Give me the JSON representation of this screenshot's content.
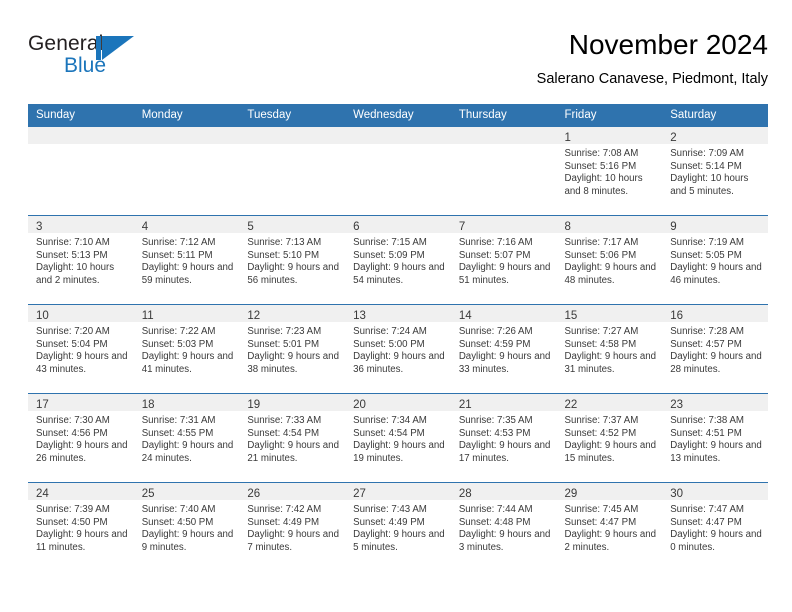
{
  "brand": {
    "name_part1": "General",
    "name_part2": "Blue",
    "flag_icon": "blue-flag-triangle",
    "color_primary": "#1b75bb"
  },
  "header": {
    "title": "November 2024",
    "subtitle": "Salerano Canavese, Piedmont, Italy"
  },
  "theme": {
    "header_blue": "#2f73ae",
    "date_strip_gray": "#f0f0f0",
    "text_color": "#3a3a3a"
  },
  "calendar": {
    "day_headers": [
      "Sunday",
      "Monday",
      "Tuesday",
      "Wednesday",
      "Thursday",
      "Friday",
      "Saturday"
    ],
    "weeks": [
      [
        {
          "date": "",
          "sunrise": "",
          "sunset": "",
          "daylight": "",
          "empty": true
        },
        {
          "date": "",
          "sunrise": "",
          "sunset": "",
          "daylight": "",
          "empty": true
        },
        {
          "date": "",
          "sunrise": "",
          "sunset": "",
          "daylight": "",
          "empty": true
        },
        {
          "date": "",
          "sunrise": "",
          "sunset": "",
          "daylight": "",
          "empty": true
        },
        {
          "date": "",
          "sunrise": "",
          "sunset": "",
          "daylight": "",
          "empty": true
        },
        {
          "date": "1",
          "sunrise": "Sunrise: 7:08 AM",
          "sunset": "Sunset: 5:16 PM",
          "daylight": "Daylight: 10 hours and 8 minutes.",
          "empty": false
        },
        {
          "date": "2",
          "sunrise": "Sunrise: 7:09 AM",
          "sunset": "Sunset: 5:14 PM",
          "daylight": "Daylight: 10 hours and 5 minutes.",
          "empty": false
        }
      ],
      [
        {
          "date": "3",
          "sunrise": "Sunrise: 7:10 AM",
          "sunset": "Sunset: 5:13 PM",
          "daylight": "Daylight: 10 hours and 2 minutes.",
          "empty": false
        },
        {
          "date": "4",
          "sunrise": "Sunrise: 7:12 AM",
          "sunset": "Sunset: 5:11 PM",
          "daylight": "Daylight: 9 hours and 59 minutes.",
          "empty": false
        },
        {
          "date": "5",
          "sunrise": "Sunrise: 7:13 AM",
          "sunset": "Sunset: 5:10 PM",
          "daylight": "Daylight: 9 hours and 56 minutes.",
          "empty": false
        },
        {
          "date": "6",
          "sunrise": "Sunrise: 7:15 AM",
          "sunset": "Sunset: 5:09 PM",
          "daylight": "Daylight: 9 hours and 54 minutes.",
          "empty": false
        },
        {
          "date": "7",
          "sunrise": "Sunrise: 7:16 AM",
          "sunset": "Sunset: 5:07 PM",
          "daylight": "Daylight: 9 hours and 51 minutes.",
          "empty": false
        },
        {
          "date": "8",
          "sunrise": "Sunrise: 7:17 AM",
          "sunset": "Sunset: 5:06 PM",
          "daylight": "Daylight: 9 hours and 48 minutes.",
          "empty": false
        },
        {
          "date": "9",
          "sunrise": "Sunrise: 7:19 AM",
          "sunset": "Sunset: 5:05 PM",
          "daylight": "Daylight: 9 hours and 46 minutes.",
          "empty": false
        }
      ],
      [
        {
          "date": "10",
          "sunrise": "Sunrise: 7:20 AM",
          "sunset": "Sunset: 5:04 PM",
          "daylight": "Daylight: 9 hours and 43 minutes.",
          "empty": false
        },
        {
          "date": "11",
          "sunrise": "Sunrise: 7:22 AM",
          "sunset": "Sunset: 5:03 PM",
          "daylight": "Daylight: 9 hours and 41 minutes.",
          "empty": false
        },
        {
          "date": "12",
          "sunrise": "Sunrise: 7:23 AM",
          "sunset": "Sunset: 5:01 PM",
          "daylight": "Daylight: 9 hours and 38 minutes.",
          "empty": false
        },
        {
          "date": "13",
          "sunrise": "Sunrise: 7:24 AM",
          "sunset": "Sunset: 5:00 PM",
          "daylight": "Daylight: 9 hours and 36 minutes.",
          "empty": false
        },
        {
          "date": "14",
          "sunrise": "Sunrise: 7:26 AM",
          "sunset": "Sunset: 4:59 PM",
          "daylight": "Daylight: 9 hours and 33 minutes.",
          "empty": false
        },
        {
          "date": "15",
          "sunrise": "Sunrise: 7:27 AM",
          "sunset": "Sunset: 4:58 PM",
          "daylight": "Daylight: 9 hours and 31 minutes.",
          "empty": false
        },
        {
          "date": "16",
          "sunrise": "Sunrise: 7:28 AM",
          "sunset": "Sunset: 4:57 PM",
          "daylight": "Daylight: 9 hours and 28 minutes.",
          "empty": false
        }
      ],
      [
        {
          "date": "17",
          "sunrise": "Sunrise: 7:30 AM",
          "sunset": "Sunset: 4:56 PM",
          "daylight": "Daylight: 9 hours and 26 minutes.",
          "empty": false
        },
        {
          "date": "18",
          "sunrise": "Sunrise: 7:31 AM",
          "sunset": "Sunset: 4:55 PM",
          "daylight": "Daylight: 9 hours and 24 minutes.",
          "empty": false
        },
        {
          "date": "19",
          "sunrise": "Sunrise: 7:33 AM",
          "sunset": "Sunset: 4:54 PM",
          "daylight": "Daylight: 9 hours and 21 minutes.",
          "empty": false
        },
        {
          "date": "20",
          "sunrise": "Sunrise: 7:34 AM",
          "sunset": "Sunset: 4:54 PM",
          "daylight": "Daylight: 9 hours and 19 minutes.",
          "empty": false
        },
        {
          "date": "21",
          "sunrise": "Sunrise: 7:35 AM",
          "sunset": "Sunset: 4:53 PM",
          "daylight": "Daylight: 9 hours and 17 minutes.",
          "empty": false
        },
        {
          "date": "22",
          "sunrise": "Sunrise: 7:37 AM",
          "sunset": "Sunset: 4:52 PM",
          "daylight": "Daylight: 9 hours and 15 minutes.",
          "empty": false
        },
        {
          "date": "23",
          "sunrise": "Sunrise: 7:38 AM",
          "sunset": "Sunset: 4:51 PM",
          "daylight": "Daylight: 9 hours and 13 minutes.",
          "empty": false
        }
      ],
      [
        {
          "date": "24",
          "sunrise": "Sunrise: 7:39 AM",
          "sunset": "Sunset: 4:50 PM",
          "daylight": "Daylight: 9 hours and 11 minutes.",
          "empty": false
        },
        {
          "date": "25",
          "sunrise": "Sunrise: 7:40 AM",
          "sunset": "Sunset: 4:50 PM",
          "daylight": "Daylight: 9 hours and 9 minutes.",
          "empty": false
        },
        {
          "date": "26",
          "sunrise": "Sunrise: 7:42 AM",
          "sunset": "Sunset: 4:49 PM",
          "daylight": "Daylight: 9 hours and 7 minutes.",
          "empty": false
        },
        {
          "date": "27",
          "sunrise": "Sunrise: 7:43 AM",
          "sunset": "Sunset: 4:49 PM",
          "daylight": "Daylight: 9 hours and 5 minutes.",
          "empty": false
        },
        {
          "date": "28",
          "sunrise": "Sunrise: 7:44 AM",
          "sunset": "Sunset: 4:48 PM",
          "daylight": "Daylight: 9 hours and 3 minutes.",
          "empty": false
        },
        {
          "date": "29",
          "sunrise": "Sunrise: 7:45 AM",
          "sunset": "Sunset: 4:47 PM",
          "daylight": "Daylight: 9 hours and 2 minutes.",
          "empty": false
        },
        {
          "date": "30",
          "sunrise": "Sunrise: 7:47 AM",
          "sunset": "Sunset: 4:47 PM",
          "daylight": "Daylight: 9 hours and 0 minutes.",
          "empty": false
        }
      ]
    ]
  }
}
